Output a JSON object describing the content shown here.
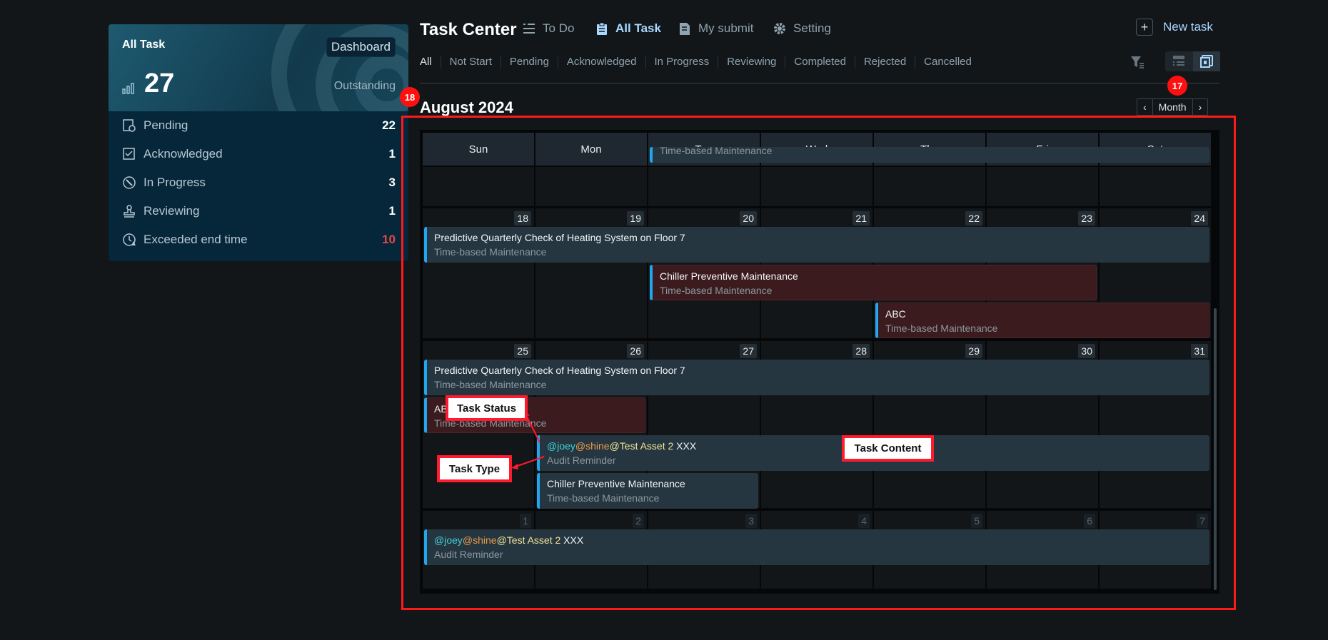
{
  "summary": {
    "title": "All Task",
    "dashboard_label": "Dashboard",
    "total": "27",
    "total_label": "Outstanding",
    "stats": [
      {
        "label": "Pending",
        "count": "22",
        "icon": "pending-icon"
      },
      {
        "label": "Acknowledged",
        "count": "1",
        "icon": "acknowledged-icon"
      },
      {
        "label": "In Progress",
        "count": "3",
        "icon": "in-progress-icon"
      },
      {
        "label": "Reviewing",
        "count": "1",
        "icon": "reviewing-icon"
      },
      {
        "label": "Exceeded end time",
        "count": "10",
        "icon": "exceeded-icon",
        "color": "#e5484d"
      }
    ]
  },
  "header": {
    "title": "Task Center",
    "nav": [
      {
        "label": "To Do",
        "icon": "checklist-icon"
      },
      {
        "label": "All Task",
        "icon": "clipboard-icon",
        "active": true
      },
      {
        "label": "My submit",
        "icon": "document-icon"
      },
      {
        "label": "Setting",
        "icon": "gear-icon"
      }
    ],
    "new_task": "New task"
  },
  "filters": [
    "All",
    "Not Start",
    "Pending",
    "Acknowledged",
    "In Progress",
    "Reviewing",
    "Completed",
    "Rejected",
    "Cancelled"
  ],
  "calendar": {
    "month_title": "August 2024",
    "prev": "‹",
    "view": "Month",
    "next": "›",
    "weekdays": [
      "Sun",
      "Mon",
      "Tue",
      "Wed",
      "Thu",
      "Fri",
      "Sat"
    ],
    "weeks": [
      {
        "days": [],
        "events": [
          {
            "title": "",
            "type": "Time-based Maintenance",
            "start": 2,
            "end": 6,
            "status": "normal"
          }
        ]
      },
      {
        "days": [
          "18",
          "19",
          "20",
          "21",
          "22",
          "23",
          "24"
        ],
        "events": [
          {
            "title": "Predictive Quarterly Check of Heating System on Floor 7",
            "type": "Time-based Maintenance",
            "start": 0,
            "end": 6,
            "status": "normal"
          },
          {
            "title": "Chiller Preventive Maintenance",
            "type": "Time-based Maintenance",
            "start": 2,
            "end": 5,
            "status": "overdue"
          },
          {
            "title": "ABC",
            "type": "Time-based Maintenance",
            "start": 4,
            "end": 6,
            "status": "overdue"
          }
        ]
      },
      {
        "days": [
          "25",
          "26",
          "27",
          "28",
          "29",
          "30",
          "31"
        ],
        "events": [
          {
            "title": "Predictive Quarterly Check of Heating System on Floor 7",
            "type": "Time-based Maintenance",
            "start": 0,
            "end": 6,
            "status": "normal"
          },
          {
            "title": "ABC",
            "type": "Time-based Maintenance",
            "start": 0,
            "end": 1,
            "status": "overdue"
          },
          {
            "mentions": [
              "@joey",
              "@shine",
              "@Test Asset 2"
            ],
            "title": " XXX",
            "type": "Audit Reminder",
            "start": 1,
            "end": 6,
            "status": "normal"
          },
          {
            "title": "Chiller Preventive Maintenance",
            "type": "Time-based Maintenance",
            "start": 1,
            "end": 2,
            "status": "normal"
          }
        ]
      },
      {
        "days": [
          "1",
          "2",
          "3",
          "4",
          "5",
          "6",
          "7"
        ],
        "other_month": true,
        "events": [
          {
            "mentions": [
              "@joey",
              "@shine",
              "@Test Asset 2"
            ],
            "title": " XXX",
            "type": "Audit Reminder",
            "start": 0,
            "end": 6,
            "status": "normal"
          }
        ]
      }
    ]
  },
  "annotations": {
    "badges": [
      "18",
      "17"
    ],
    "callouts": [
      "Task Status",
      "Task Type",
      "Task Content"
    ]
  },
  "colors": {
    "accent": "#22a6ef",
    "overdue_bg": "#3b1b1e",
    "event_bg": "#263640",
    "annotation": "#ff1a1a"
  }
}
